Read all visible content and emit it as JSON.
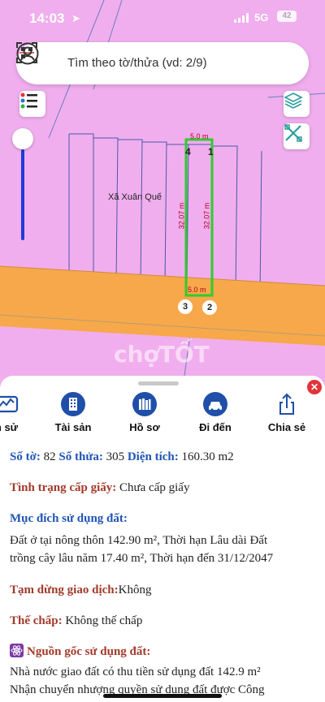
{
  "status_bar": {
    "time": "14:03",
    "network": "5G",
    "battery": "42"
  },
  "search": {
    "placeholder": "Tìm theo tờ/thửa (vd: 2/9)"
  },
  "map": {
    "commune_label": "Xã Xuân Quế",
    "top_width": "5.0 m",
    "bottom_width": "5.0 m",
    "left_length": "32.07 m",
    "right_length": "32.07 m",
    "corners": [
      "1",
      "2",
      "3",
      "4"
    ],
    "watermark": "chợTỐT",
    "colors": {
      "land": "#f0aeee",
      "road": "#f7a84a",
      "parcel_outline": "#2ecc2e"
    }
  },
  "actions": [
    {
      "label": "h sử",
      "icon": "history-chart-icon"
    },
    {
      "label": "Tài sản",
      "icon": "building-icon"
    },
    {
      "label": "Hồ sơ",
      "icon": "folder-icon"
    },
    {
      "label": "Đi đến",
      "icon": "car-icon"
    },
    {
      "label": "Chia sẻ",
      "icon": "share-icon"
    }
  ],
  "details": {
    "sheet_label": "Số tờ:",
    "sheet_value": "82",
    "parcel_label": "Số thửa:",
    "parcel_value": "305",
    "area_label": "Diện tích:",
    "area_value": "160.30 m2",
    "cert_label": "Tình trạng cấp giấy:",
    "cert_value": "Chưa cấp giấy",
    "purpose_label": "Mục đích sử dụng đất:",
    "purpose_line1": "Đất ở tại nông thôn 142.90 m², Thời hạn Lâu dài Đất",
    "purpose_line2": "trồng cây lâu năm 17.40 m², Thời hạn đến 31/12/2047",
    "suspend_label": "Tạm dừng giao dịch:",
    "suspend_value": "Không",
    "mortgage_label": "Thế chấp:",
    "mortgage_value": "Không thế chấp",
    "origin_label": "Nguồn gốc sử dụng đất:",
    "origin_line1": "Nhà nước giao đất có thu tiền sử dụng đất 142.9 m²",
    "origin_line2": "Nhận chuyển nhượng quyền sử dụng đất được Công"
  }
}
